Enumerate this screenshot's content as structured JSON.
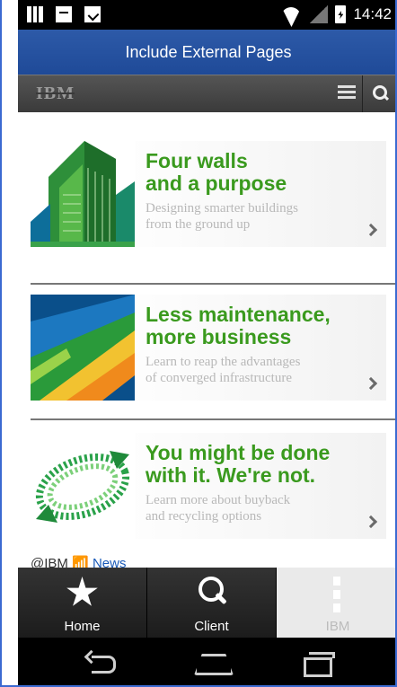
{
  "status_bar": {
    "time": "14:42"
  },
  "title_bar": {
    "title": "Include External Pages"
  },
  "ibm_bar": {
    "logo_text": "IBM"
  },
  "cards": [
    {
      "headline_1": "Four walls",
      "headline_2": "and a purpose",
      "sub_1": "Designing smarter buildings",
      "sub_2": "from the ground up"
    },
    {
      "headline_1": "Less maintenance,",
      "headline_2": "more business",
      "sub_1": "Learn to reap the advantages",
      "sub_2": "of converged infrastructure"
    },
    {
      "headline_1": "You might be done",
      "headline_2": "with it. We're not.",
      "sub_1": "Learn more about buyback",
      "sub_2": "and recycling options"
    }
  ],
  "footer_note": {
    "prefix": "@IBM",
    "link": "News"
  },
  "tab_bar": {
    "tabs": [
      {
        "label": "Home"
      },
      {
        "label": "Client"
      },
      {
        "label": "IBM"
      }
    ]
  },
  "colors": {
    "title_bar": "#2d5aa8",
    "headline_green": "#3a9a1e",
    "frame_border": "#3b6ad1"
  }
}
